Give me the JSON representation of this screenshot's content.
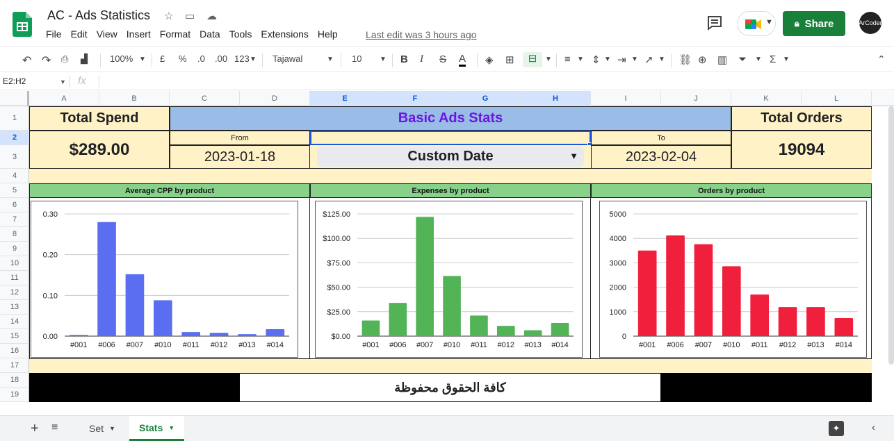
{
  "app": {
    "doc_title": "AC - Ads Statistics",
    "menu": [
      "File",
      "Edit",
      "View",
      "Insert",
      "Format",
      "Data",
      "Tools",
      "Extensions",
      "Help"
    ],
    "last_edit": "Last edit was 3 hours ago",
    "share_label": "Share",
    "avatar_text": "ArCoder",
    "brand_color": "#188038"
  },
  "toolbar": {
    "zoom": "100%",
    "currency": "£",
    "percent": "%",
    "dec_dec": ".0",
    "dec_inc": ".00",
    "format_more": "123",
    "font": "Tajawal",
    "font_size": "10",
    "bold": "B",
    "italic": "I",
    "strike": "S",
    "text_color": "A"
  },
  "formula_bar": {
    "name_box": "E2:H2",
    "fx": "fx"
  },
  "columns": [
    "A",
    "B",
    "C",
    "D",
    "E",
    "F",
    "G",
    "H",
    "I",
    "J",
    "K",
    "L"
  ],
  "rows": [
    "1",
    "2",
    "3",
    "4",
    "5",
    "6",
    "7",
    "8",
    "9",
    "10",
    "11",
    "12",
    "13",
    "14",
    "15",
    "16",
    "17",
    "18",
    "19"
  ],
  "dashboard": {
    "total_spend_label": "Total Spend",
    "total_spend_value": "$289.00",
    "header": "Basic Ads Stats",
    "from_label": "From",
    "from_date": "2023-01-18",
    "range_select": "Custom Date",
    "to_label": "To",
    "to_date": "2023-02-04",
    "total_orders_label": "Total Orders",
    "total_orders_value": "19094",
    "rights_text": "كافة الحقوق محفوظة",
    "header_color": "#99bde6",
    "header_text_color": "#6a18e0",
    "cream_color": "#fef2c6",
    "green_color": "#88d18a"
  },
  "chart_data": [
    {
      "type": "bar",
      "title": "Average CPP by product",
      "categories": [
        "#001",
        "#006",
        "#007",
        "#010",
        "#011",
        "#012",
        "#013",
        "#014"
      ],
      "values": [
        0.003,
        0.28,
        0.152,
        0.088,
        0.01,
        0.008,
        0.005,
        0.017
      ],
      "ylim": [
        0,
        0.3
      ],
      "yticks": [
        "0.00",
        "0.10",
        "0.20",
        "0.30"
      ],
      "ytick_values": [
        0,
        0.1,
        0.2,
        0.3
      ],
      "color": "#5b6df0",
      "grid": true
    },
    {
      "type": "bar",
      "title": "Expenses by product",
      "categories": [
        "#001",
        "#006",
        "#007",
        "#010",
        "#011",
        "#012",
        "#013",
        "#014"
      ],
      "values": [
        16,
        34,
        122,
        61.5,
        21,
        10.5,
        6,
        13.5
      ],
      "ylim": [
        0,
        125
      ],
      "yticks": [
        "$0.00",
        "$25.00",
        "$50.00",
        "$75.00",
        "$100.00",
        "$125.00"
      ],
      "ytick_values": [
        0,
        25,
        50,
        75,
        100,
        125
      ],
      "color": "#53b457",
      "grid": true
    },
    {
      "type": "bar",
      "title": "Orders by product",
      "categories": [
        "#001",
        "#006",
        "#007",
        "#010",
        "#011",
        "#012",
        "#013",
        "#014"
      ],
      "values": [
        3500,
        4120,
        3760,
        2860,
        1700,
        1190,
        1190,
        740
      ],
      "ylim": [
        0,
        5000
      ],
      "yticks": [
        "0",
        "1000",
        "2000",
        "3000",
        "4000",
        "5000"
      ],
      "ytick_values": [
        0,
        1000,
        2000,
        3000,
        4000,
        5000
      ],
      "color": "#f01f3c",
      "grid": true
    }
  ],
  "sheets": {
    "tabs": [
      "Set",
      "Stats"
    ],
    "active": "Stats"
  }
}
